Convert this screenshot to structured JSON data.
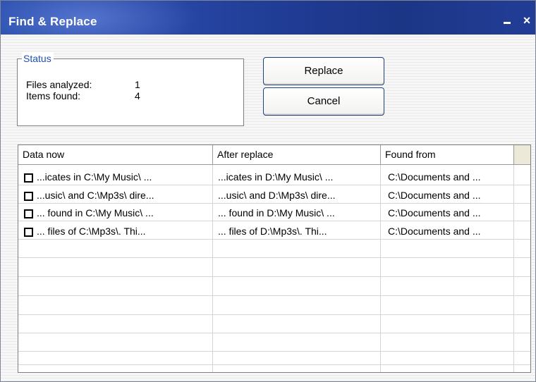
{
  "window": {
    "title": "Find & Replace",
    "minimize_label": "minimize",
    "close_label": "close"
  },
  "status": {
    "legend": "Status",
    "files_analyzed_label": "Files analyzed:",
    "files_analyzed_value": "1",
    "items_found_label": "Items found:",
    "items_found_value": "4"
  },
  "buttons": {
    "replace": "Replace",
    "cancel": "Cancel"
  },
  "table": {
    "columns": [
      "Data now",
      "After replace",
      "Found from"
    ],
    "rows": [
      {
        "checked": false,
        "data_now": "...icates in C:\\My Music\\ ...",
        "after_replace": "...icates in D:\\My Music\\ ...",
        "found_from": "C:\\Documents and ..."
      },
      {
        "checked": false,
        "data_now": "...usic\\ and C:\\Mp3s\\ dire...",
        "after_replace": "...usic\\ and D:\\Mp3s\\ dire...",
        "found_from": "C:\\Documents and ..."
      },
      {
        "checked": false,
        "data_now": "... found in C:\\My Music\\ ...",
        "after_replace": "... found in D:\\My Music\\ ...",
        "found_from": "C:\\Documents and ..."
      },
      {
        "checked": false,
        "data_now": "... files of C:\\Mp3s\\. Thi...",
        "after_replace": "... files of D:\\Mp3s\\. Thi...",
        "found_from": "C:\\Documents and ..."
      }
    ]
  },
  "colors": {
    "title_bar": "#2847a6",
    "legend_text": "#1f4fb5",
    "button_border": "#1f3f7f"
  }
}
